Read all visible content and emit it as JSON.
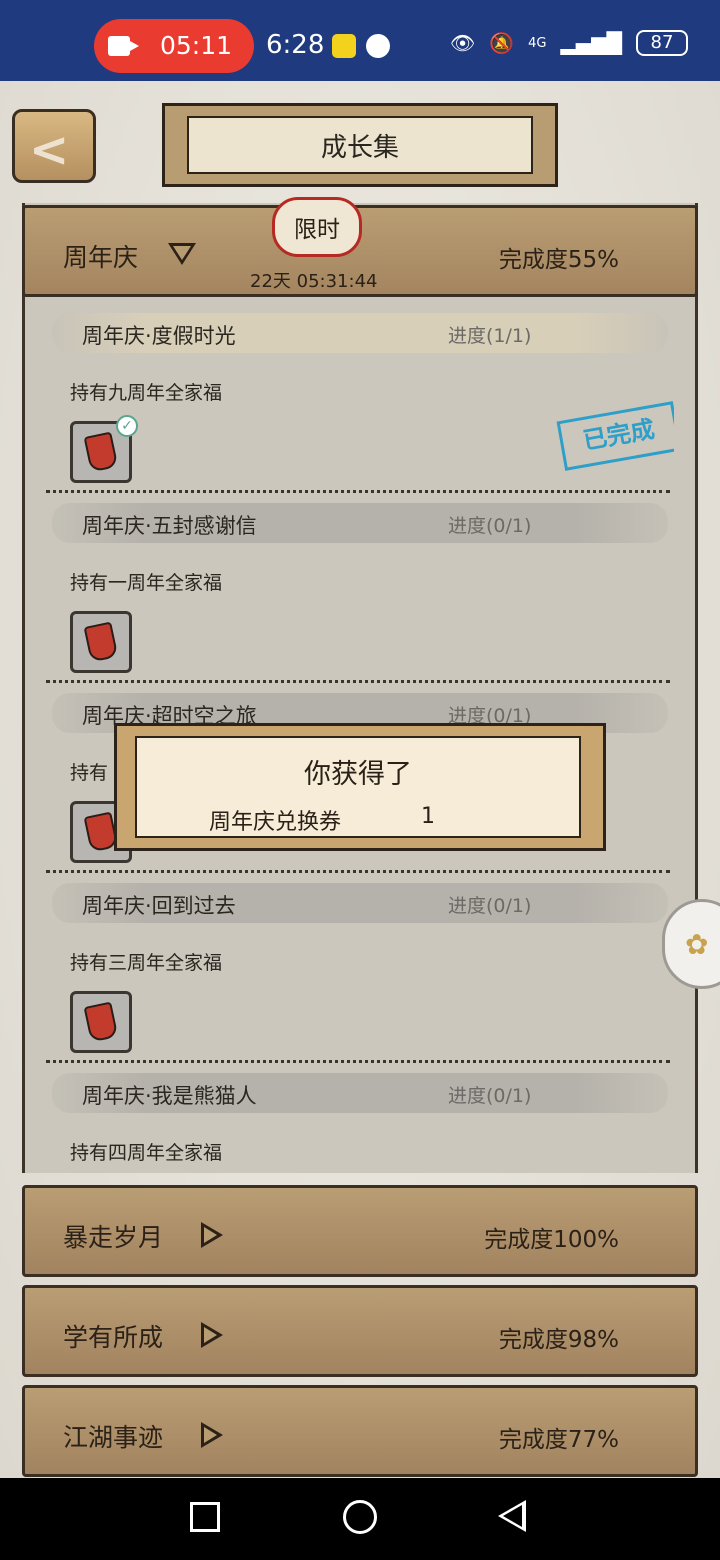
{
  "status_bar": {
    "recording_time": "05:11",
    "clock": "6:28",
    "battery": "87",
    "network": "4G"
  },
  "header": {
    "title": "成长集"
  },
  "active_category": {
    "name": "周年庆",
    "limited_badge": "限时",
    "countdown": "22天 05:31:44",
    "completion": "完成度55%"
  },
  "tasks": [
    {
      "name": "周年庆·度假时光",
      "progress": "进度(1/1)",
      "requirement": "持有九周年全家福",
      "completed": true,
      "stamp": "已完成"
    },
    {
      "name": "周年庆·五封感谢信",
      "progress": "进度(0/1)",
      "requirement": "持有一周年全家福",
      "completed": false
    },
    {
      "name": "周年庆·超时空之旅",
      "progress": "进度(0/1)",
      "requirement": "持有",
      "completed": false
    },
    {
      "name": "周年庆·回到过去",
      "progress": "进度(0/1)",
      "requirement": "持有三周年全家福",
      "completed": false
    },
    {
      "name": "周年庆·我是熊猫人",
      "progress": "进度(0/1)",
      "requirement": "持有四周年全家福",
      "completed": false
    }
  ],
  "popup": {
    "title": "你获得了",
    "item_name": "周年庆兑换券",
    "item_qty": "1"
  },
  "categories": [
    {
      "name": "暴走岁月",
      "completion": "完成度100%"
    },
    {
      "name": "学有所成",
      "completion": "完成度98%"
    },
    {
      "name": "江湖事迹",
      "completion": "完成度77%"
    }
  ],
  "colors": {
    "status_bar": "#1f3a7e",
    "record_pill": "#ea3b31",
    "stamp": "#2e9fc9",
    "parchment": "#b99d73"
  }
}
